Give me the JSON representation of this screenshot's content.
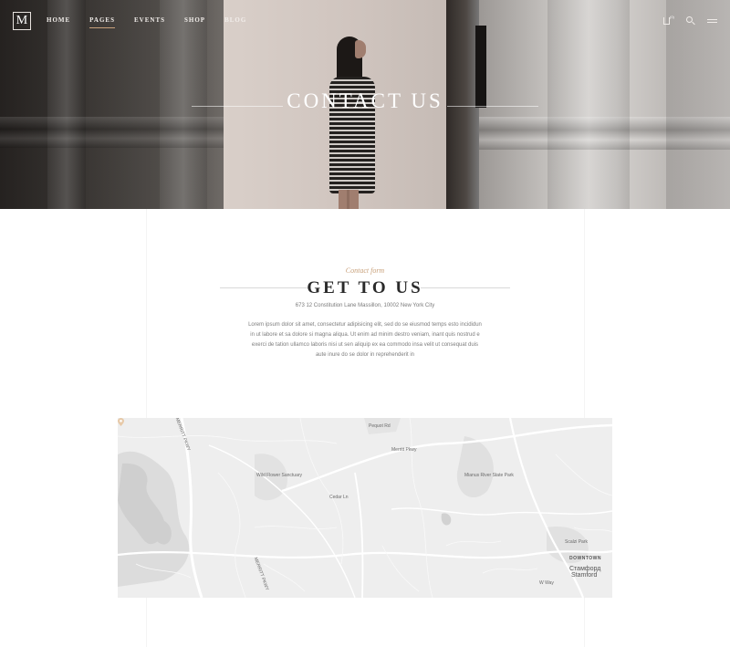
{
  "nav": {
    "logo": "M",
    "items": [
      {
        "label": "HOME"
      },
      {
        "label": "PAGES"
      },
      {
        "label": "EVENTS"
      },
      {
        "label": "SHOP"
      },
      {
        "label": "BLOG"
      }
    ],
    "active_index": 1,
    "cart_count": "(0)"
  },
  "hero": {
    "title": "CONTACT US"
  },
  "contact": {
    "subtitle": "Contact form",
    "heading": "GET TO US",
    "address": "673 12 Constitution Lane Massillon, 10002 New York City",
    "body_lines": [
      "Lorem ipsum dolor sit amet, consectetur adipisicing elit, sed do se eiusmod temps esto incididun",
      "in ut labore et sa dolore si magna aliqua.  Ut enim ad minim destro veniam, inant quis nostrud e",
      "exerci de tation ullamco laboris nisi ut sen aliquip ex ea commodo insa velit ut consequat duis",
      "aute inure do se dolor in reprehenderit in"
    ]
  },
  "map": {
    "labels": {
      "parkway_n": "MERRITT PKWY",
      "parkway_s": "MERRITT PKWY",
      "pequot": "Pequot Rd",
      "wildflower": "Wild Flower Sanctuary",
      "mianus": "Mianus River State Park",
      "cedar": "Cedar Ln",
      "wayside": "W Way",
      "stamford_pkwy": "Merritt Pkwy",
      "downtown": "DOWNTOWN",
      "stamford_cyr": "Стамфорд",
      "stamford": "Stamford",
      "scalzi": "Scalzi Park"
    }
  },
  "colors": {
    "accent": "#c9a27c",
    "heading": "#2a2a2a",
    "text": "#7d7d7d"
  }
}
